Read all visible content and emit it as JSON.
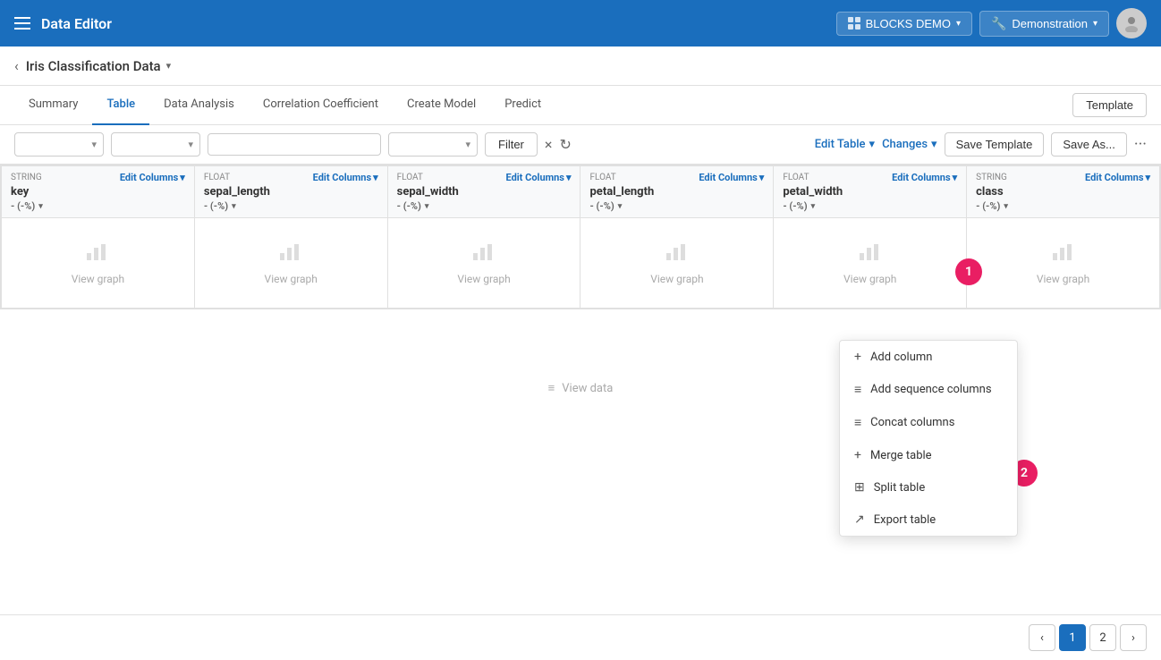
{
  "header": {
    "menu_icon": "≡",
    "title": "Data Editor",
    "blocks_demo_label": "BLOCKS DEMO",
    "demonstration_label": "Demonstration"
  },
  "sub_header": {
    "back_icon": "‹",
    "dataset_title": "Iris Classification Data",
    "dropdown_arrow": "▾"
  },
  "tabs": [
    {
      "id": "summary",
      "label": "Summary",
      "active": false
    },
    {
      "id": "table",
      "label": "Table",
      "active": true
    },
    {
      "id": "data-analysis",
      "label": "Data Analysis",
      "active": false
    },
    {
      "id": "correlation",
      "label": "Correlation Coefficient",
      "active": false
    },
    {
      "id": "create-model",
      "label": "Create Model",
      "active": false
    },
    {
      "id": "predict",
      "label": "Predict",
      "active": false
    }
  ],
  "template_btn_label": "Template",
  "toolbar": {
    "filter_label": "Filter",
    "clear_icon": "×",
    "refresh_icon": "↻",
    "edit_table_label": "Edit Table",
    "changes_label": "Changes",
    "save_template_label": "Save Template",
    "save_as_label": "Save As...",
    "more_icon": "···"
  },
  "columns": [
    {
      "type": "STRING",
      "name": "key",
      "format": "- (-%)",
      "edit_label": "Edit Columns"
    },
    {
      "type": "FLOAT",
      "name": "sepal_length",
      "format": "- (-%)",
      "edit_label": "Edit Columns"
    },
    {
      "type": "FLOAT",
      "name": "sepal_width",
      "format": "- (-%)",
      "edit_label": "Edit Columns"
    },
    {
      "type": "FLOAT",
      "name": "petal_length",
      "format": "- (-%)",
      "edit_label": "Edit Columns"
    },
    {
      "type": "FLOAT",
      "name": "petal_width",
      "format": "- (-%)",
      "edit_label": "Edit Columns"
    },
    {
      "type": "STRING",
      "name": "class",
      "format": "- (-%)",
      "edit_label": "Edit Columns"
    }
  ],
  "graph_label": "View graph",
  "empty_state": {
    "icon": "≡",
    "label": "View data"
  },
  "dropdown_menu": {
    "items": [
      {
        "id": "add-column",
        "icon": "+",
        "label": "Add column"
      },
      {
        "id": "add-sequence",
        "icon": "≡",
        "label": "Add sequence columns"
      },
      {
        "id": "concat",
        "icon": "≡",
        "label": "Concat columns"
      },
      {
        "id": "merge",
        "icon": "+",
        "label": "Merge table"
      },
      {
        "id": "split",
        "icon": "⊞",
        "label": "Split table"
      },
      {
        "id": "export",
        "icon": "↗",
        "label": "Export table"
      }
    ]
  },
  "pagination": {
    "prev_icon": "‹",
    "next_icon": "›",
    "pages": [
      "1",
      "2"
    ],
    "active_page": "1"
  },
  "step_badges": {
    "badge1": "1",
    "badge2": "2"
  },
  "colors": {
    "primary": "#1a6ebd",
    "header_bg": "#1a6ebd",
    "badge_color": "#e91e63"
  }
}
